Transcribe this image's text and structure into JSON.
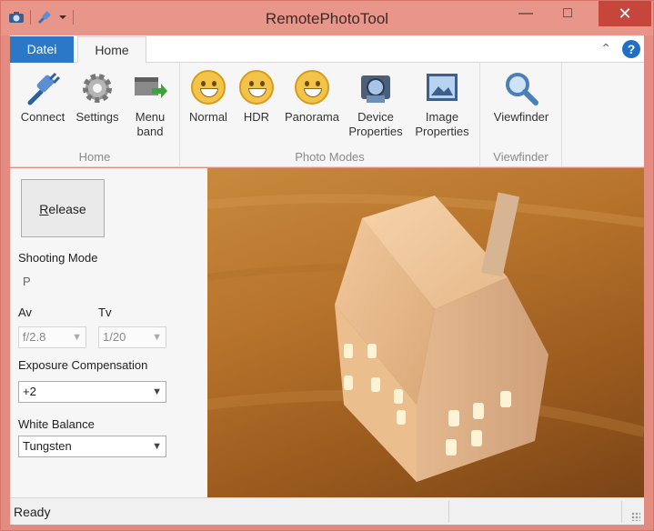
{
  "window": {
    "title": "RemotePhotoTool"
  },
  "ribbon": {
    "tabs": [
      {
        "label": "Datei"
      },
      {
        "label": "Home"
      }
    ],
    "groups": [
      {
        "label": "Home",
        "buttons": [
          {
            "label": "Connect"
          },
          {
            "label": "Settings"
          },
          {
            "label": "Menu band"
          }
        ]
      },
      {
        "label": "Photo Modes",
        "buttons": [
          {
            "label": "Normal"
          },
          {
            "label": "HDR"
          },
          {
            "label": "Panorama"
          },
          {
            "label": "Device Properties"
          },
          {
            "label": "Image Properties"
          }
        ]
      },
      {
        "label": "Viewfinder",
        "buttons": [
          {
            "label": "Viewfinder"
          }
        ]
      }
    ]
  },
  "panel": {
    "release_label": "Release",
    "shooting_mode_label": "Shooting Mode",
    "shooting_mode_value": "P",
    "av_label": "Av",
    "av_value": "f/2.8",
    "tv_label": "Tv",
    "tv_value": "1/20",
    "exposure_label": "Exposure Compensation",
    "exposure_value": "+2",
    "wb_label": "White Balance",
    "wb_value": "Tungsten"
  },
  "status": {
    "text": "Ready"
  },
  "colors": {
    "accent": "#2b78c6",
    "titlebar": "#e8958a",
    "close": "#c7463c"
  }
}
